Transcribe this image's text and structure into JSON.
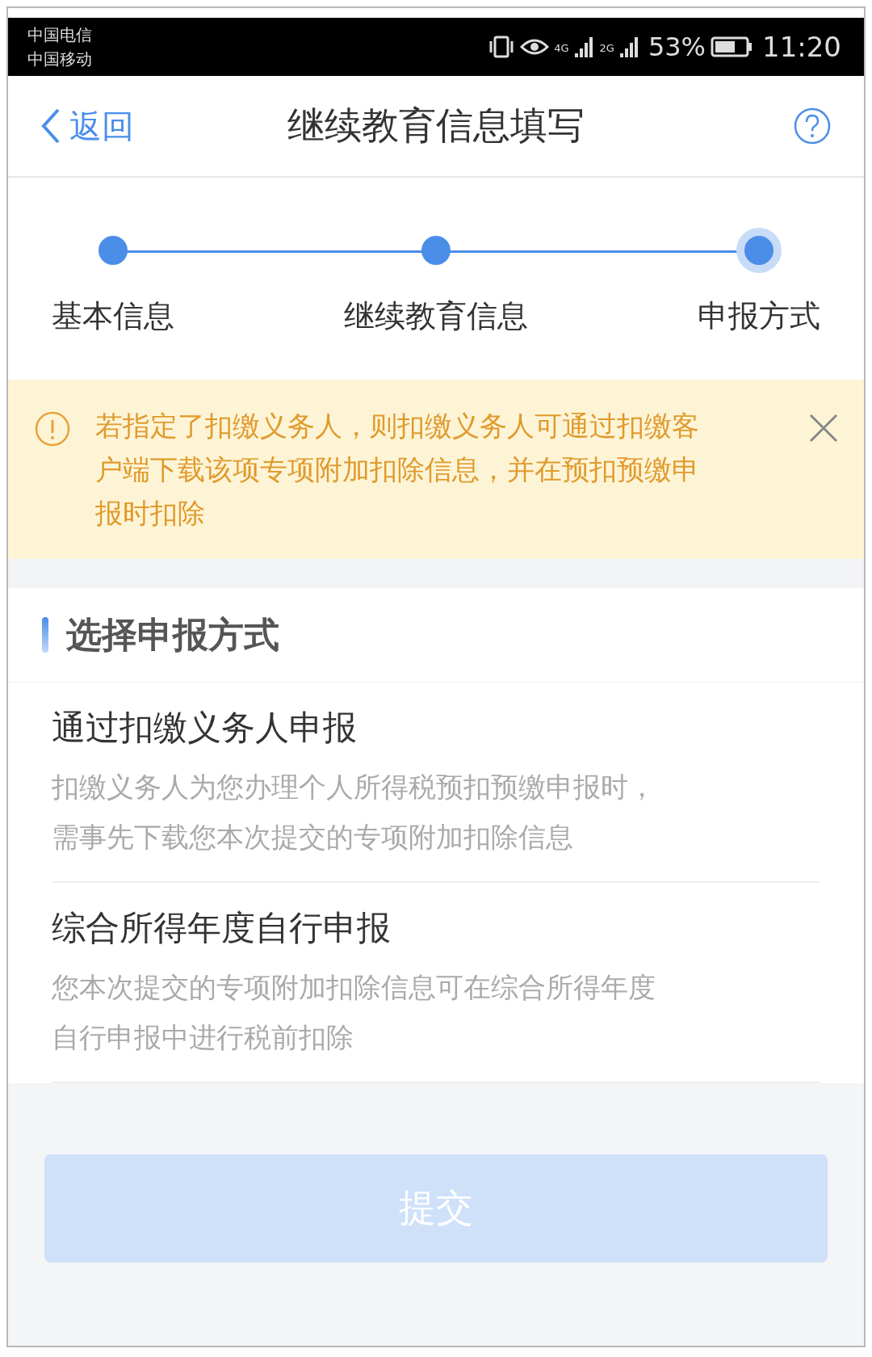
{
  "status_bar": {
    "carriers": [
      "中国电信",
      "中国移动"
    ],
    "network_labels": [
      "4G",
      "2G"
    ],
    "battery": "53%",
    "time": "11:20"
  },
  "nav": {
    "back": "返回",
    "title": "继续教育信息填写"
  },
  "steps": [
    {
      "label": "基本信息",
      "selected": false
    },
    {
      "label": "继续教育信息",
      "selected": false
    },
    {
      "label": "申报方式",
      "selected": true
    }
  ],
  "notice": {
    "text": "若指定了扣缴义务人，则扣缴义务人可通过扣缴客户端下载该项专项附加扣除信息，并在预扣预缴申报时扣除"
  },
  "section": {
    "title": "选择申报方式"
  },
  "options": [
    {
      "title": "通过扣缴义务人申报",
      "description": "扣缴义务人为您办理个人所得税预扣预缴申报时，需事先下载您本次提交的专项附加扣除信息"
    },
    {
      "title": "综合所得年度自行申报",
      "description": "您本次提交的专项附加扣除信息可在综合所得年度自行申报中进行税前扣除"
    }
  ],
  "submit": {
    "label": "提交",
    "disabled": true
  }
}
